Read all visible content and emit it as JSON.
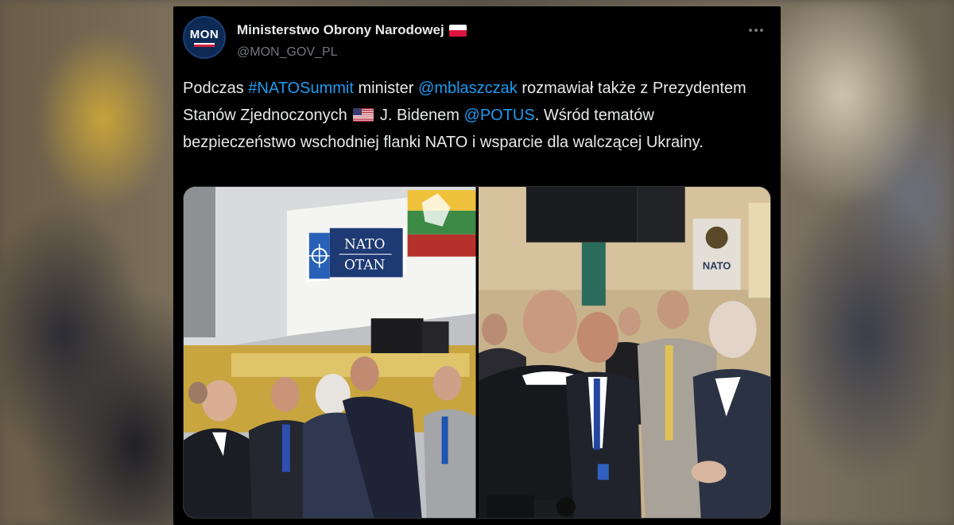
{
  "account": {
    "display_name": "Ministerstwo Obrony Narodowej",
    "handle": "@MON_GOV_PL",
    "avatar_text": "MON",
    "name_flag_icon": "poland-flag-icon"
  },
  "menu": {
    "more_icon": "more-horizontal-icon"
  },
  "tweet": {
    "segments": [
      {
        "text": "Podczas ",
        "type": "text"
      },
      {
        "text": "#NATOSummit",
        "type": "hashtag"
      },
      {
        "text": " minister ",
        "type": "text"
      },
      {
        "text": "@mblaszczak",
        "type": "mention"
      },
      {
        "text": " rozmawiał także z Prezydentem Stanów Zjednoczonych ",
        "type": "text"
      },
      {
        "text": "us-flag-emoji",
        "type": "emoji"
      },
      {
        "text": " J. Bidenem ",
        "type": "text"
      },
      {
        "text": "@POTUS",
        "type": "mention"
      },
      {
        "text": ". Wśród tematów bezpieczeństwo wschodniej flanki NATO i wsparcie dla walczącej Ukrainy.",
        "type": "text"
      }
    ]
  },
  "media": {
    "photo1": {
      "banner_line1": "NATO",
      "banner_line2": "OTAN"
    },
    "photo2": {
      "sign_text": "NATO"
    }
  },
  "colors": {
    "link": "#1d9bf0",
    "text": "#e7e9ea",
    "secondary": "#71767b",
    "background": "#000000"
  }
}
